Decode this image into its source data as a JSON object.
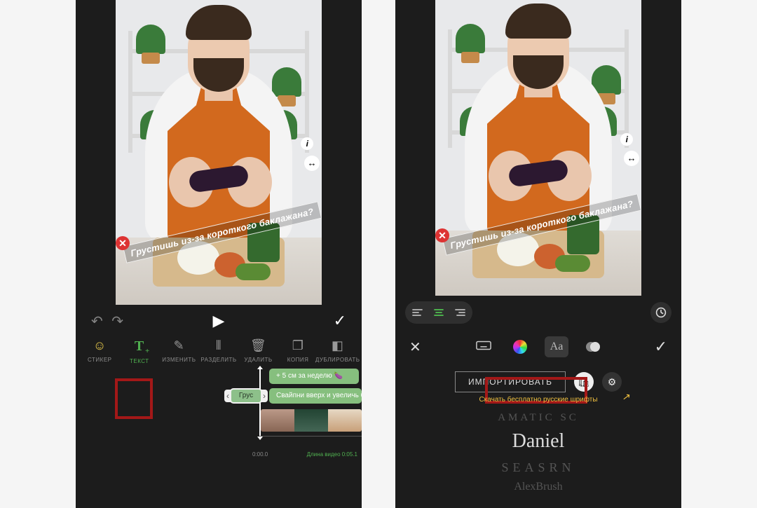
{
  "caption_text": "Грустишь из-за короткого баклажана?",
  "left": {
    "tools": {
      "sticker": "СТИКЕР",
      "text": "ТЕКСТ",
      "edit": "ИЗМЕНИТЬ",
      "split": "РАЗДЕЛИТЬ",
      "delete": "УДАЛИТЬ",
      "copy": "КОПИЯ",
      "duplicate": "ДУБЛИРОВАТЬ"
    },
    "timeline": {
      "clip1": "+ 5 см за неделю 🍆",
      "clip_sel": "Грус",
      "clip2": "Свайпни вверх и увеличь бак",
      "zero": "0:00.0",
      "duration": "Длина видео 0:05.1"
    }
  },
  "right": {
    "font_tab": "Aa",
    "import_btn": "ИМПОРТИРОВАТЬ",
    "hint": "Скачать бесплатно русские шрифты",
    "fonts": {
      "amatic": "AMATIC SC",
      "daniel": "Daniel",
      "seasrn": "SEASRN",
      "alexbrush": "AlexBrush"
    }
  }
}
